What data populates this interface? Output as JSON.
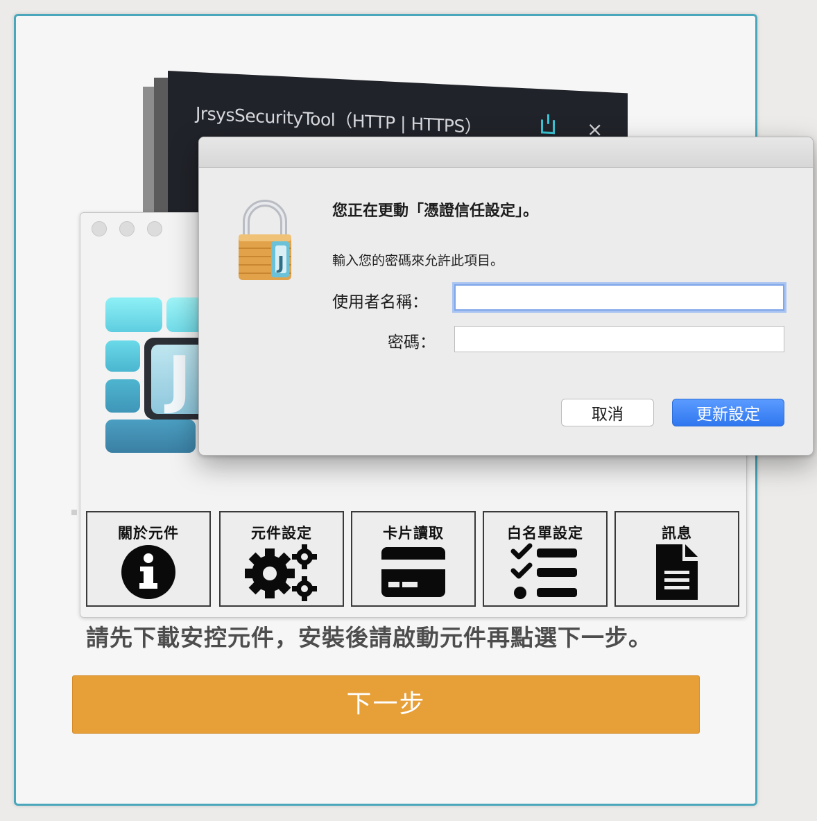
{
  "back_window": {
    "title": "JrsysSecurityTool（HTTP | HTTPS）",
    "close_glyph": "×"
  },
  "toolbar": {
    "items": [
      {
        "label": "關於元件",
        "icon": "info-icon"
      },
      {
        "label": "元件設定",
        "icon": "gears-icon"
      },
      {
        "label": "卡片讀取",
        "icon": "credit-card-icon"
      },
      {
        "label": "白名單設定",
        "icon": "checklist-icon"
      },
      {
        "label": "訊息",
        "icon": "document-icon"
      }
    ]
  },
  "dialog": {
    "heading": "您正在更動「憑證信任設定」。",
    "subtext": "輸入您的密碼來允許此項目。",
    "username_label": "使用者名稱：",
    "username_value": "",
    "password_label": "密碼：",
    "password_value": "",
    "cancel_label": "取消",
    "confirm_label": "更新設定"
  },
  "page": {
    "instruction": "請先下載安控元件，安裝後請啟動元件再點選下一步。",
    "next_label": "下一步"
  },
  "colors": {
    "card_border": "#4aa7bb",
    "next_button": "#e79f38",
    "confirm_button": "#2f77f0"
  }
}
